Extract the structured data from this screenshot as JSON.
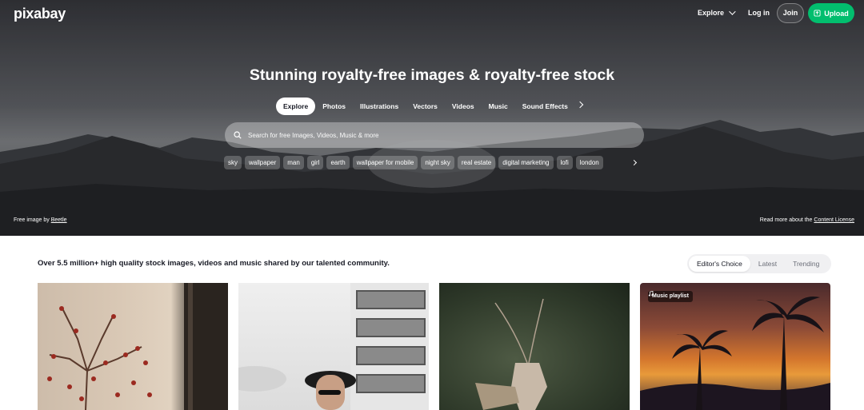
{
  "header": {
    "logo": "pixabay",
    "explore_label": "Explore",
    "login_label": "Log in",
    "join_label": "Join",
    "upload_label": "Upload"
  },
  "hero": {
    "headline": "Stunning royalty-free images & royalty-free stock",
    "media_tabs": [
      "Explore",
      "Photos",
      "Illustrations",
      "Vectors",
      "Videos",
      "Music",
      "Sound Effects"
    ],
    "search": {
      "placeholder": "Search for free Images, Videos, Music & more"
    },
    "tags": [
      "sky",
      "wallpaper",
      "man",
      "girl",
      "earth",
      "wallpaper for mobile",
      "night sky",
      "real estate",
      "digital marketing",
      "lofi",
      "london"
    ],
    "credit_prefix": "Free image by",
    "credit_author": "Beetle",
    "license_prefix": "Read more about the",
    "license_link": "Content License"
  },
  "content": {
    "tagline": "Over 5.5 million+ high quality stock images, videos and music shared by our talented community.",
    "sort_options": [
      "Editor's Choice",
      "Latest",
      "Trending"
    ],
    "music_badge": "Music playlist"
  },
  "colors": {
    "upload_green": "#02be6e",
    "text_dark": "#191b26"
  }
}
